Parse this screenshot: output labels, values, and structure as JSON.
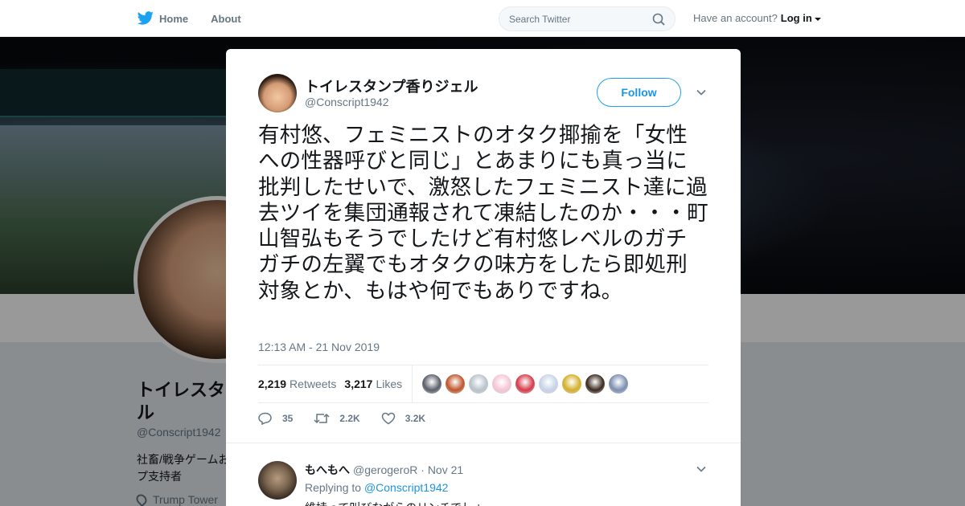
{
  "nav": {
    "home": "Home",
    "about": "About",
    "search_placeholder": "Search Twitter",
    "have_account": "Have an account?",
    "login": "Log in"
  },
  "background_profile": {
    "name": "トイレスタ\nル",
    "handle": "@Conscript1942",
    "bio": "社畜/戦争ゲームお\nプ支持者",
    "location": "Trump Tower"
  },
  "tweet": {
    "author_name": "トイレスタンプ香りジェル",
    "author_handle": "@Conscript1942",
    "follow_label": "Follow",
    "text": "有村悠、フェミニストのオタク揶揄を「女性への性器呼びと同じ」とあまりにも真っ当に批判したせいで、激怒したフェミニスト達に過去ツイを集団通報されて凍結したのか・・・町山智弘もそうでしたけど有村悠レベルのガチガチの左翼でもオタクの味方をしたら即処刑対象とか、もはや何でもありですね。",
    "timestamp": "12:13 AM - 21 Nov 2019",
    "retweets_count": "2,219",
    "retweets_label": "Retweets",
    "likes_count": "3,217",
    "likes_label": "Likes",
    "replies_short": "35",
    "retweets_short": "2.2K",
    "likes_short": "3.2K"
  },
  "likers": [
    "#5a5f6a",
    "#c0552a",
    "#b9c2cc",
    "#f4c6d4",
    "#d63b4a",
    "#c7d3e6",
    "#d4b02a",
    "#3b2a20",
    "#7b8fb0"
  ],
  "reply": {
    "author_name": "もへもへ",
    "author_handle": "@gerogeroR",
    "date": "· Nov 21",
    "replying_to_prefix": "Replying to",
    "replying_to_handle": "@Conscript1942",
    "text": "維持って叫びながらのリンチでしょ"
  },
  "colors": {
    "accent": "#1da1f2",
    "link": "#1b95e0",
    "text": "#14171a",
    "secondary": "#657786"
  }
}
